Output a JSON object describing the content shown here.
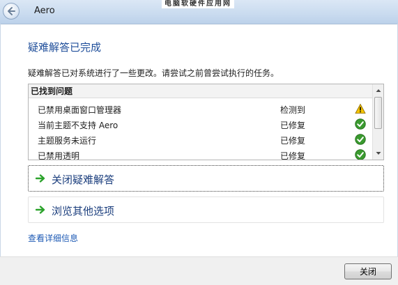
{
  "window": {
    "title": "Aero",
    "watermark": "电脑软硬件应用网"
  },
  "page": {
    "heading": "疑难解答已完成",
    "description": "疑难解答已对系统进行了一些更改。请尝试之前曾尝试执行的任务。"
  },
  "problems": {
    "header": "已找到问题",
    "items": [
      {
        "name": "已禁用桌面窗口管理器",
        "status": "检测到",
        "icon": "warning-icon"
      },
      {
        "name": "当前主题不支持 Aero",
        "status": "已修复",
        "icon": "check-icon"
      },
      {
        "name": "主题服务未运行",
        "status": "已修复",
        "icon": "check-icon"
      },
      {
        "name": "已禁用透明",
        "status": "已修复",
        "icon": "check-icon"
      }
    ]
  },
  "options": {
    "close_troubleshooter": "关闭疑难解答",
    "browse_other": "浏览其他选项"
  },
  "links": {
    "details": "查看详细信息"
  },
  "footer": {
    "close_label": "关闭"
  },
  "colors": {
    "heading": "#1f4e9a",
    "link": "#1f5bb5",
    "arrow_green": "#2ca32c",
    "check_green": "#3a9a2f",
    "warning_yellow": "#f5c400"
  }
}
